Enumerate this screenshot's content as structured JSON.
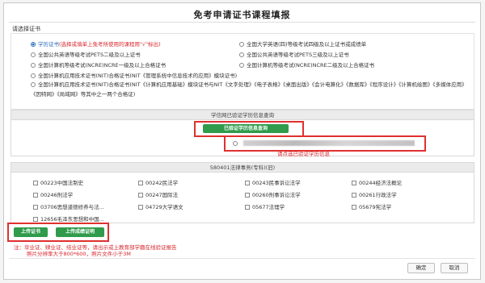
{
  "dialog": {
    "title": "免考申请证书课程填报",
    "section_label": "请选择证书"
  },
  "cert_options": [
    {
      "label": "学历证书",
      "note": "(选择或填单上免考所使用的课程用\"√\"标出)",
      "selected": true
    },
    {
      "label": "全国大学英语(四)等级考试四级及以上证书或成绩单",
      "selected": false
    },
    {
      "label": "全国公共英语等级考试PETS二级及以上证书",
      "selected": false
    },
    {
      "label": "全国公共英语等级考试PETS三级及以上证书",
      "selected": false
    },
    {
      "label": "全国计算机等级考试(NCRE)NCRE一级及以上合格证书",
      "selected": false
    },
    {
      "label": "全国计算机等级考试(NCRE)NCRE二级及以上合格证书",
      "selected": false
    },
    {
      "label": "全国计算机应用技术证书(NIT)合格证书(NIT《管理系统中信息技术的应用》模块证书)",
      "selected": false
    },
    {
      "label": "全国计算机应用技术证书(NIT)合格证书(NIT《计算机应用基础》模块证书与NIT《文字处理》《电子表格》《桌面出版》《会计电算化》《数据库》《程序设计》《计算机绘图》《多媒体应用》《因特网》《局域网》等其中之一两个合格证)",
      "selected": false
    }
  ],
  "verify": {
    "header": "学信网已验证学历信息查询",
    "button": "已验证学历信息查询",
    "hint": "请点选已验证学历信息"
  },
  "courses": {
    "header": "580401法律事务(专科)(旧)",
    "items": [
      "00223中国法制史",
      "00242民法学",
      "00243民事诉讼法学",
      "00244经济法概论",
      "00246刑法学",
      "00247国际法",
      "00260刑事诉讼法学",
      "00261行政法学",
      "03706思想道德修养与法...",
      "04729大学语文",
      "05677法理学",
      "05679宪法学",
      "12656毛泽东思想和中国..."
    ]
  },
  "upload": {
    "cert_button": "上传证书",
    "score_button": "上传成绩证明",
    "note_line1": "注：毕业证、肄业证、结业证等，请出示或上教育部学籍在线验证报告",
    "note_line2": "照片分辨率大于800*600，照片文件小于3M"
  },
  "actions": {
    "ok": "确定",
    "cancel": "取消"
  },
  "colors": {
    "accent_green": "#2f9b4b",
    "highlight_red": "#e0302f",
    "hint_red": "#d9262c"
  }
}
